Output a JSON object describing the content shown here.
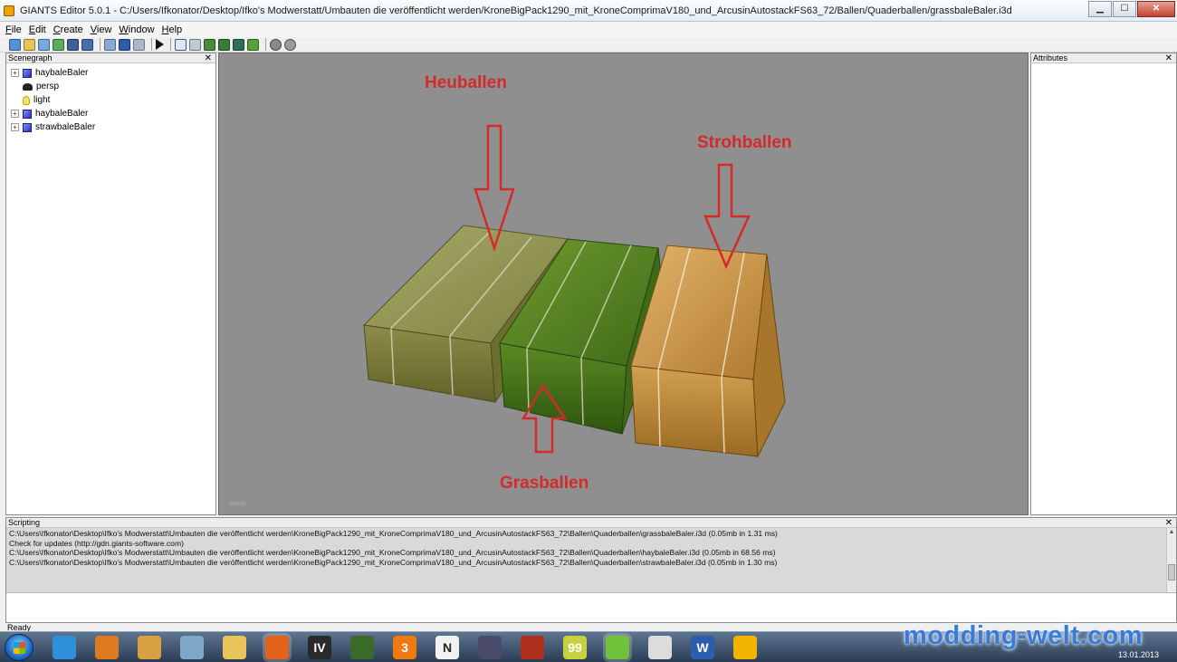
{
  "window": {
    "title": "GIANTS Editor 5.0.1 - C:/Users/Ifkonator/Desktop/Ifko's Modwerstatt/Umbauten die veröffentlicht werden/KroneBigPack1290_mit_KroneComprimaV180_und_ArcusinAutostackFS63_72/Ballen/Quaderballen/grassbaleBaler.i3d",
    "controls": {
      "minimize": "▁",
      "maximize": "☐",
      "close": "✕"
    }
  },
  "menu": [
    "File",
    "Edit",
    "Create",
    "View",
    "Window",
    "Help"
  ],
  "toolbar_icons": [
    "new-icon",
    "open-icon",
    "import-icon",
    "export-icon",
    "save-icon",
    "save-all-icon",
    "undo-icon",
    "redo-icon",
    "refresh-icon",
    "play-icon",
    "select-icon",
    "move-icon",
    "terrain-icon",
    "paint-icon",
    "foliage-icon",
    "grass-icon",
    "settings-icon",
    "tools-icon"
  ],
  "panels": {
    "scenegraph": {
      "title": "Scenegraph",
      "close": "✕"
    },
    "attributes": {
      "title": "Attributes",
      "close": "✕"
    },
    "scripting": {
      "title": "Scripting",
      "close": "✕"
    }
  },
  "scenegraph": {
    "items": [
      {
        "label": "haybaleBaler",
        "icon": "cube-icon",
        "expandable": true
      },
      {
        "label": "persp",
        "icon": "camera-icon",
        "expandable": false
      },
      {
        "label": "light",
        "icon": "light-icon",
        "expandable": false
      },
      {
        "label": "haybaleBaler",
        "icon": "cube-icon",
        "expandable": true
      },
      {
        "label": "strawbaleBaler",
        "icon": "cube-icon",
        "expandable": true
      }
    ]
  },
  "viewport": {
    "camera_label": "persp",
    "annotations": {
      "hay": "Heuballen",
      "straw": "Strohballen",
      "grass": "Grasballen"
    },
    "annotation_color": "#d42a2a",
    "background": "#8f8f8f"
  },
  "console": {
    "lines": [
      "C:\\Users\\Ifkonator\\Desktop\\Ifko's Modwerstatt\\Umbauten die veröffentlicht werden\\KroneBigPack1290_mit_KroneComprimaV180_und_ArcusinAutostackFS63_72\\Ballen\\Quaderballen\\grassbaleBaler.i3d (0.05mb in 1.31 ms)",
      "Check for updates (http://gdn.giants-software.com)",
      "C:\\Users\\Ifkonator\\Desktop\\Ifko's Modwerstatt\\Umbauten die veröffentlicht werden\\KroneBigPack1290_mit_KroneComprimaV180_und_ArcusinAutostackFS63_72\\Ballen\\Quaderballen\\haybaleBaler.i3d (0.05mb in 68.56 ms)",
      "C:\\Users\\Ifkonator\\Desktop\\Ifko's Modwerstatt\\Umbauten die veröffentlicht werden\\KroneBigPack1290_mit_KroneComprimaV180_und_ArcusinAutostackFS63_72\\Ballen\\Quaderballen\\strawbaleBaler.i3d (0.05mb in 1.30 ms)"
    ]
  },
  "status": {
    "text": "Ready"
  },
  "taskbar": {
    "apps": [
      {
        "name": "internet-explorer-icon",
        "color": "#2f8fd8"
      },
      {
        "name": "media-player-icon",
        "color": "#e07a1f"
      },
      {
        "name": "paint-app-icon",
        "color": "#d8a040"
      },
      {
        "name": "tools-app-icon",
        "color": "#7fa8c8"
      },
      {
        "name": "explorer-folder-icon",
        "color": "#e8c35a"
      },
      {
        "name": "firefox-icon",
        "color": "#e5621c"
      },
      {
        "name": "gta-iv-icon",
        "color": "#2a2a2a",
        "text": "IV"
      },
      {
        "name": "tractor-icon",
        "color": "#3a6b2a"
      },
      {
        "name": "game-3-icon",
        "color": "#f07a10",
        "text": "3"
      },
      {
        "name": "notepad-icon",
        "color": "#f2f2f2",
        "text": "N"
      },
      {
        "name": "truck-icon",
        "color": "#4a4a6a"
      },
      {
        "name": "harvester-icon",
        "color": "#b03020"
      },
      {
        "name": "monitor-99-icon",
        "color": "#c8d040",
        "text": "99"
      },
      {
        "name": "icq-icon",
        "color": "#6fc23a"
      },
      {
        "name": "inkscape-icon",
        "color": "#dcdcdc"
      },
      {
        "name": "word-icon",
        "color": "#2b5fad",
        "text": "W"
      },
      {
        "name": "giants-editor-icon",
        "color": "#f2b400"
      }
    ],
    "watermark": "modding-welt.com",
    "date": "13.01.2013"
  }
}
